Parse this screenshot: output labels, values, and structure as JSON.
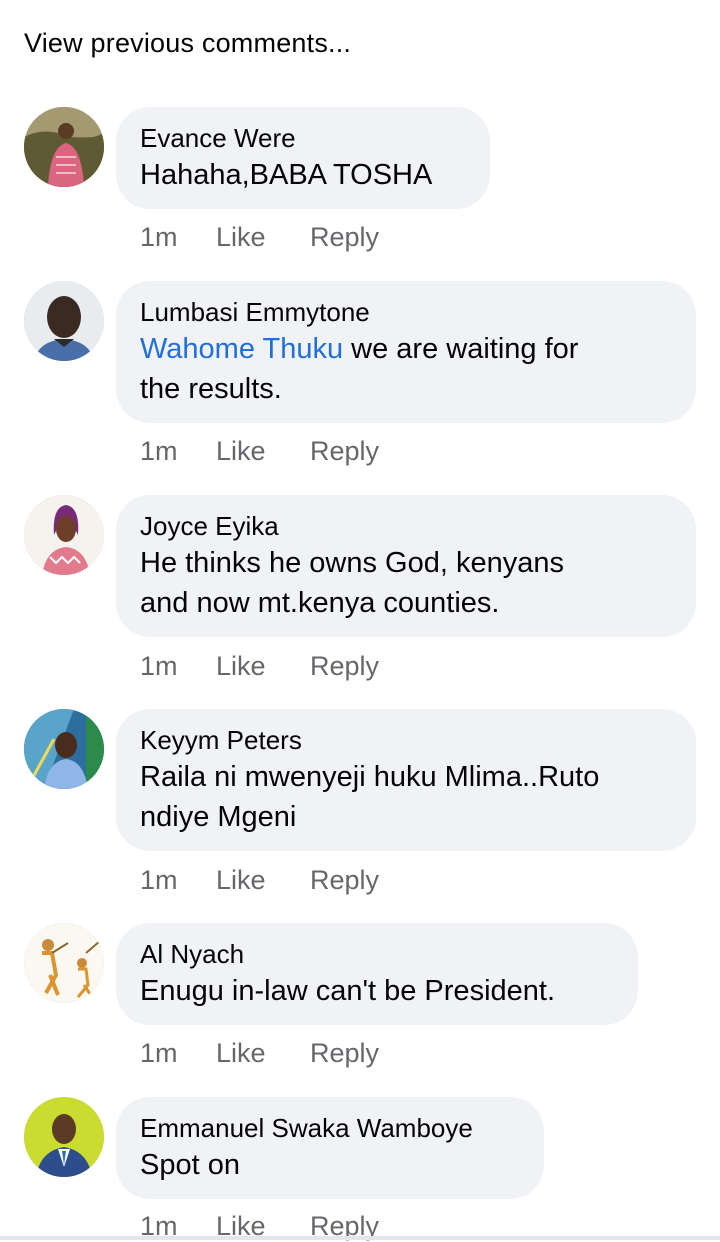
{
  "view_previous": "View previous comments...",
  "comments": [
    {
      "author": "Evance Were",
      "text": "Hahaha,BABA TOSHA",
      "time": "1m",
      "like": "Like",
      "reply": "Reply"
    },
    {
      "author": "Lumbasi Emmytone",
      "mention": "Wahome Thuku",
      "text_line1": " we are waiting for",
      "text_line2": "the results.",
      "time": "1m",
      "like": "Like",
      "reply": "Reply"
    },
    {
      "author": "Joyce Eyika",
      "text_line1": "He thinks he owns God, kenyans",
      "text_line2": "and now mt.kenya counties.",
      "time": "1m",
      "like": "Like",
      "reply": "Reply"
    },
    {
      "author": "Keyym Peters",
      "text_line1": "Raila ni mwenyeji huku Mlima..Ruto",
      "text_line2": "ndiye Mgeni",
      "time": "1m",
      "like": "Like",
      "reply": "Reply"
    },
    {
      "author": "Al Nyach",
      "text": "Enugu in-law can't be President.",
      "time": "1m",
      "like": "Like",
      "reply": "Reply"
    },
    {
      "author": "Emmanuel Swaka Wamboye",
      "text": "Spot on",
      "time": "1m",
      "like": "Like",
      "reply": "Reply"
    }
  ],
  "colors": {
    "bubble": "#f0f2f5",
    "mention": "#216fdb",
    "meta": "#65676b"
  }
}
